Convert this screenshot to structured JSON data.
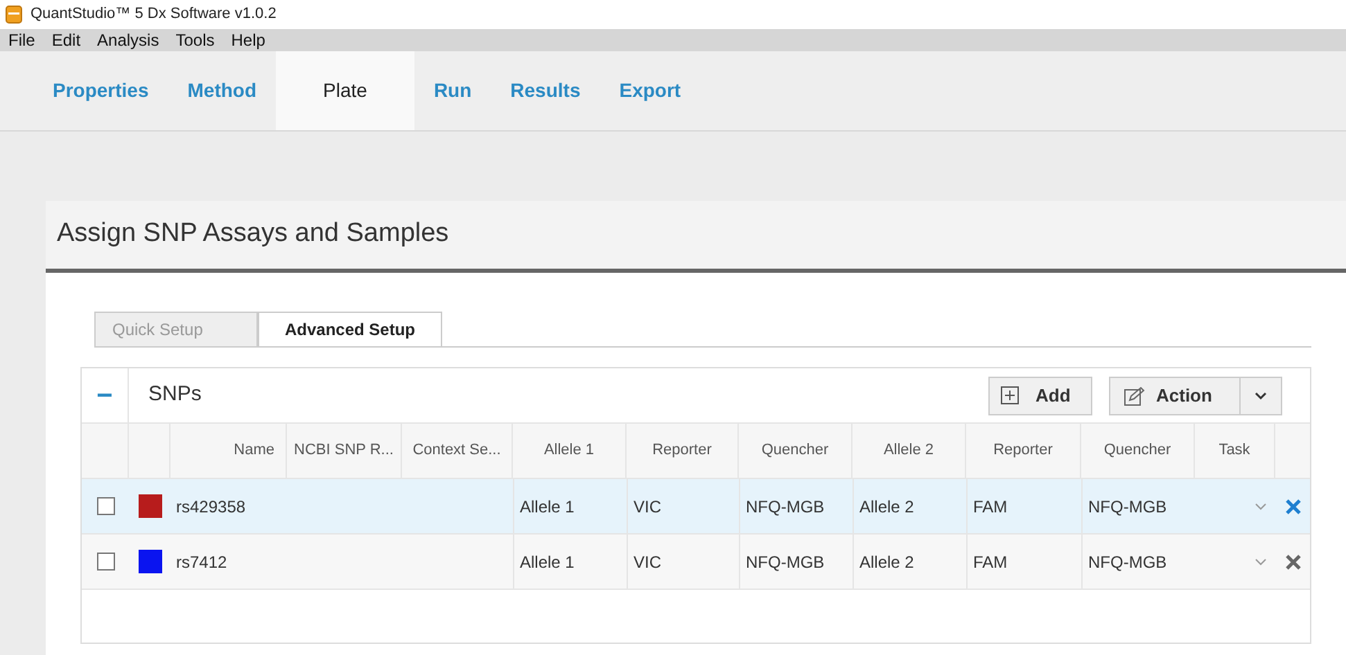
{
  "window": {
    "title": "QuantStudio™ 5 Dx Software v1.0.2"
  },
  "menu": [
    "File",
    "Edit",
    "Analysis",
    "Tools",
    "Help"
  ],
  "nav_tabs": [
    {
      "label": "Properties",
      "selected": false
    },
    {
      "label": "Method",
      "selected": false
    },
    {
      "label": "Plate",
      "selected": true
    },
    {
      "label": "Run",
      "selected": false
    },
    {
      "label": "Results",
      "selected": false
    },
    {
      "label": "Export",
      "selected": false
    }
  ],
  "panel": {
    "title": "Assign SNP Assays and Samples"
  },
  "setup_tabs": [
    {
      "label": "Quick Setup",
      "selected": false
    },
    {
      "label": "Advanced Setup",
      "selected": true
    }
  ],
  "snps": {
    "collapse_icon": "−",
    "title": "SNPs",
    "expanded": true,
    "buttons": [
      {
        "label": "Add",
        "kind": "add"
      },
      {
        "label": "Action",
        "kind": "action"
      }
    ],
    "columns": [
      "Name",
      "NCBI SNP R...",
      "Context Se...",
      "Allele 1",
      "Reporter",
      "Quencher",
      "Allele 2",
      "Reporter",
      "Quencher",
      "Task"
    ],
    "rows": [
      {
        "selected": true,
        "checked": false,
        "color": "#b71c1c",
        "cells": [
          "rs429358",
          "",
          "",
          "Allele 1",
          "VIC",
          "NFQ-MGB",
          "Allele 2",
          "FAM",
          "NFQ-MGB",
          ""
        ]
      },
      {
        "selected": false,
        "checked": false,
        "color": "#0a14f0",
        "cells": [
          "rs7412",
          "",
          "",
          "Allele 1",
          "VIC",
          "NFQ-MGB",
          "Allele 2",
          "FAM",
          "NFQ-MGB",
          ""
        ]
      }
    ]
  }
}
